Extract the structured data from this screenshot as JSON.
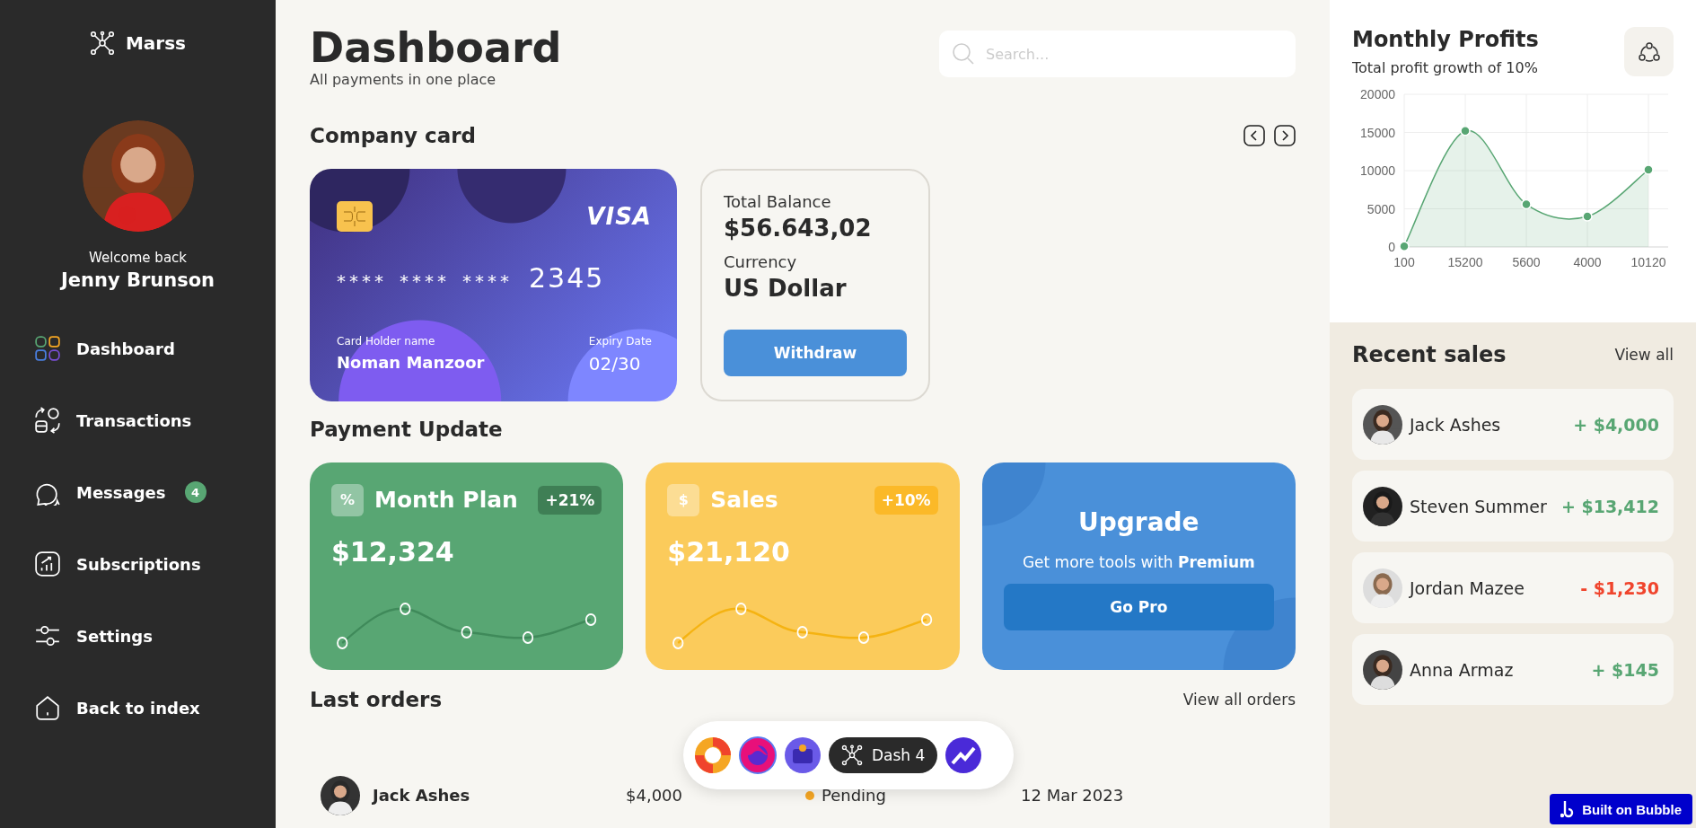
{
  "sidebar": {
    "brand": "Marss",
    "welcome": "Welcome back",
    "user_name": "Jenny Brunson",
    "items": [
      {
        "label": "Dashboard",
        "selected": true
      },
      {
        "label": "Transactions",
        "selected": false
      },
      {
        "label": "Messages",
        "selected": false,
        "badge": "4"
      },
      {
        "label": "Subscriptions",
        "selected": false
      },
      {
        "label": "Settings",
        "selected": false
      },
      {
        "label": "Back to index",
        "selected": false
      }
    ]
  },
  "header": {
    "title": "Dashboard",
    "subtitle": "All payments in one place",
    "search": {
      "placeholder": "Search..."
    }
  },
  "company_card": {
    "title": "Company card",
    "card": {
      "brand": "VISA",
      "number_groups": [
        "****",
        "****",
        "****",
        "2345"
      ],
      "holder_label": "Card Holder name",
      "holder": "Noman Manzoor",
      "expiry_label": "Expiry Date",
      "expiry": "02/30"
    },
    "balance": {
      "label": "Total Balance",
      "value": "$56.643,02",
      "currency_label": "Currency",
      "currency": "US Dollar",
      "button": "Withdraw"
    }
  },
  "payment_update": {
    "title": "Payment Update",
    "cards": [
      {
        "kind": "plan",
        "symbol": "%",
        "title": "Month Plan",
        "change": "+21%",
        "amount": "$12,324",
        "color": "#58a673"
      },
      {
        "kind": "sales",
        "symbol": "$",
        "title": "Sales",
        "change": "+10%",
        "amount": "$21,120",
        "color": "#fbcb5b"
      }
    ],
    "upgrade": {
      "title": "Upgrade",
      "text": "Get more tools with **Premium**",
      "button": "Go Pro"
    }
  },
  "last_orders": {
    "title": "Last orders",
    "link": "View all orders",
    "rows": [
      {
        "name": "Jack Ashes",
        "amount": "$4,000",
        "status": "Pending",
        "color": "#f5a623",
        "date": "12 Mar 2023"
      }
    ]
  },
  "dock": {
    "label": "Dash 4"
  },
  "monthly_profits": {
    "title": "Monthly Profits",
    "subtitle": "Total profit growth of 10%",
    "chart_data": {
      "type": "area",
      "grid": true,
      "categories": [
        "100",
        "15200",
        "5600",
        "4000",
        "10120"
      ],
      "series": [
        {
          "color": "#58a673",
          "values": [
            100,
            15200,
            5600,
            4000,
            10120
          ]
        }
      ],
      "ylim": [
        0,
        20000
      ],
      "yticks": [
        0,
        5000,
        10000,
        15000,
        20000
      ]
    }
  },
  "recent_sales": {
    "title": "Recent sales",
    "link": "View all",
    "rows": [
      {
        "name": "Jack Ashes",
        "amount": "+ $4,000",
        "color": "#58a673"
      },
      {
        "name": "Steven Summer",
        "amount": "+ $13,412",
        "color": "#58a673"
      },
      {
        "name": "Jordan Mazee",
        "amount": "- $1,230",
        "color": "#f0442c"
      },
      {
        "name": "Anna Armaz",
        "amount": "+ $145",
        "color": "#58a673"
      }
    ]
  },
  "badge": {
    "label": "Built on Bubble"
  }
}
